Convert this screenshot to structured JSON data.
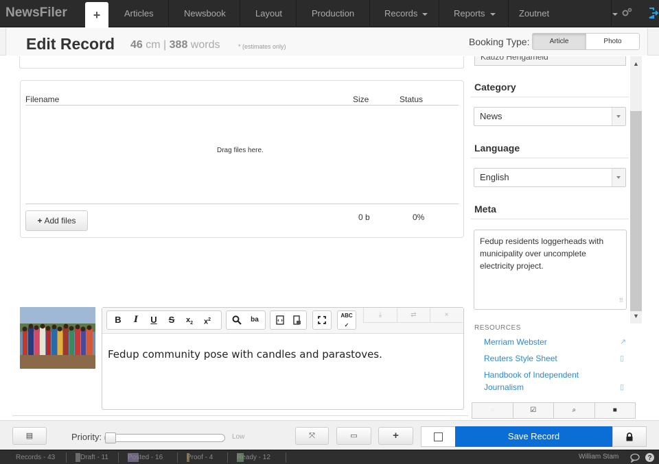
{
  "app": {
    "brand": "NewsFiler",
    "new_tab_symbol": "+",
    "nav": [
      {
        "label": "Articles"
      },
      {
        "label": "Newsbook"
      },
      {
        "label": "Layout"
      },
      {
        "label": "Production"
      },
      {
        "label": "Records",
        "dropdown": true
      },
      {
        "label": "Reports",
        "dropdown": true
      },
      {
        "label": "Zoutnet"
      }
    ]
  },
  "header": {
    "title": "Edit Record",
    "cm_value": "46",
    "cm_unit": "cm",
    "separator": "|",
    "words_value": "388",
    "words_unit": "words",
    "estimate_note": "* (estimates only)",
    "booking_type_label": "Booking Type:",
    "booking_options": [
      "Article",
      "Photo"
    ],
    "booking_selected": "Article"
  },
  "files": {
    "col_filename": "Filename",
    "col_size": "Size",
    "col_status": "Status",
    "drop_hint": "Drag files here.",
    "add_files_label": "Add files",
    "total_size": "0 b",
    "total_status": "0%"
  },
  "editor": {
    "toolbar": [
      "bold",
      "italic",
      "underline",
      "strikethrough",
      "subscript",
      "superscript",
      "find",
      "replace",
      "source",
      "page-break",
      "maximize",
      "spellcheck"
    ],
    "caption": "Fedup community pose with candles and parastoves."
  },
  "sidebar": {
    "author_partial": "Kauzo Hengameld",
    "category_heading": "Category",
    "category_value": "News",
    "language_heading": "Language",
    "language_value": "English",
    "meta_heading": "Meta",
    "meta_text": "Fedup residents loggerheads with municipality over uncomplete electricity project.",
    "resources_heading": "RESOURCES",
    "resources": [
      {
        "label": "Merriam Webster",
        "icon": "external-link-icon"
      },
      {
        "label": "Reuters Style Sheet",
        "icon": "document-icon"
      },
      {
        "label": "Handbook of Independent Journalism",
        "icon": "document-icon"
      }
    ]
  },
  "actionbar": {
    "priority_label": "Priority:",
    "priority_level_label": "Low",
    "priority_level": 0,
    "save_label": "Save Record"
  },
  "status": {
    "items": [
      {
        "label": "Records - 43"
      },
      {
        "label": "Draft - 11",
        "color": "#6b6b6b"
      },
      {
        "label": "Posted - 16",
        "color": "#7a6c8c"
      },
      {
        "label": "Proof - 4",
        "color": "#7f6a4a"
      },
      {
        "label": "Ready - 12",
        "color": "#5e7a5e"
      }
    ],
    "user": "William Stam"
  },
  "colors": {
    "accent": "#0a6ed6",
    "link": "#2a8ad4",
    "nav_bg": "#2b2b2b"
  }
}
